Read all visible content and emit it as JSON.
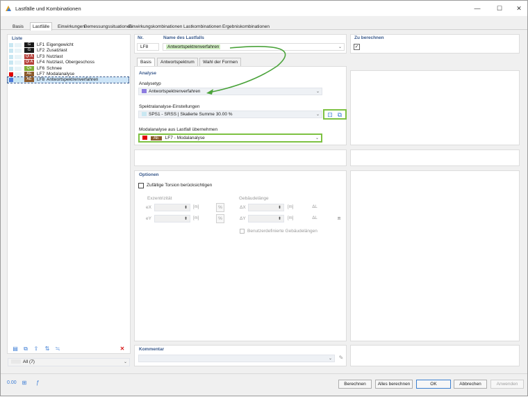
{
  "window": {
    "title": "Lastfälle und Kombinationen"
  },
  "tabs": [
    "Basis",
    "Lastfälle",
    "Einwirkungen",
    "Bemessungssituationen",
    "Einwirkungskombinationen",
    "Lastkombinationen",
    "Ergebniskombinationen"
  ],
  "active_tab": "Lastfälle",
  "list": {
    "heading": "Liste",
    "items": [
      {
        "tag": "G",
        "id": "LF1",
        "name": "Eigengewicht",
        "badge_color": "#1a1a1a",
        "color1": "#c9e7f2",
        "color2": "#e8f4f8"
      },
      {
        "tag": "G",
        "id": "LF2",
        "name": "Zusatzlast",
        "badge_color": "#1a1a1a",
        "color1": "#c9e7f2",
        "color2": "#e8f4f8"
      },
      {
        "tag": "QI A",
        "id": "LF3",
        "name": "Nutzlast",
        "badge_color": "#b5403a",
        "color1": "#c9e7f2",
        "color2": "#e8f4f8"
      },
      {
        "tag": "QI A",
        "id": "LF4",
        "name": "Nutzlast, Obergeschoss",
        "badge_color": "#b5403a",
        "color1": "#c9e7f2",
        "color2": "#e8f4f8"
      },
      {
        "tag": "Qs",
        "id": "LF6",
        "name": "Schnee",
        "badge_color": "#7fae35",
        "color1": "#c9e7f2",
        "color2": "#e8f4f8"
      },
      {
        "tag": "AE",
        "id": "LF7",
        "name": "Modalanalyse",
        "badge_color": "#8b5a2b",
        "color1": "#e00000",
        "color2": "#e8f4f8"
      },
      {
        "tag": "AE",
        "id": "LF8",
        "name": "Antwortspektrenverfahren",
        "badge_color": "#8b5a2b",
        "color1": "#4a78d8",
        "color2": "#c9e7f2"
      }
    ],
    "filter": "All (7)"
  },
  "header": {
    "nr_label": "Nr.",
    "nr_value": "LF8",
    "name_label": "Name des Lastfalls",
    "name_value": "Antwortspektrenverfahren",
    "calc_label": "Zu berechnen"
  },
  "inner_tabs": [
    "Basis",
    "Antwortspektrum",
    "Wahl der Formen"
  ],
  "analyse": {
    "heading": "Analyse",
    "type_label": "Analysetyp",
    "type_value": "Antwortspektrenverfahren",
    "spectral_label": "Spektralanalyse-Einstellungen",
    "spectral_value": "SPS1 - SRSS | Skalierte Summe 30.00 %",
    "modal_label": "Modalanalyse aus Lastfall übernehmen",
    "modal_tag": "AE",
    "modal_value": "LF7 - Modalanalyse"
  },
  "optionen": {
    "heading": "Optionen",
    "torsion_label": "Zufällige Torsion berücksichtigen",
    "exz_label": "Exzentrizität",
    "ex_label": "eX",
    "ey_label": "eY",
    "unit_m": "[m]",
    "unit_pct": "%",
    "geb_label": "Gebäudelänge",
    "dx_label": "ΔX",
    "dy_label": "ΔY",
    "custom_label": "Benutzerdefinierte Gebäudelängen"
  },
  "kommentar": {
    "heading": "Kommentar"
  },
  "footer": {
    "berechnen": "Berechnen",
    "alles_berechnen": "Alles berechnen",
    "ok": "OK",
    "abbrechen": "Abbrechen",
    "anwenden": "Anwenden"
  },
  "colors": {
    "accent": "#3a5a8c",
    "highlight_green": "#7dc142",
    "selection": "#cce4f7"
  }
}
